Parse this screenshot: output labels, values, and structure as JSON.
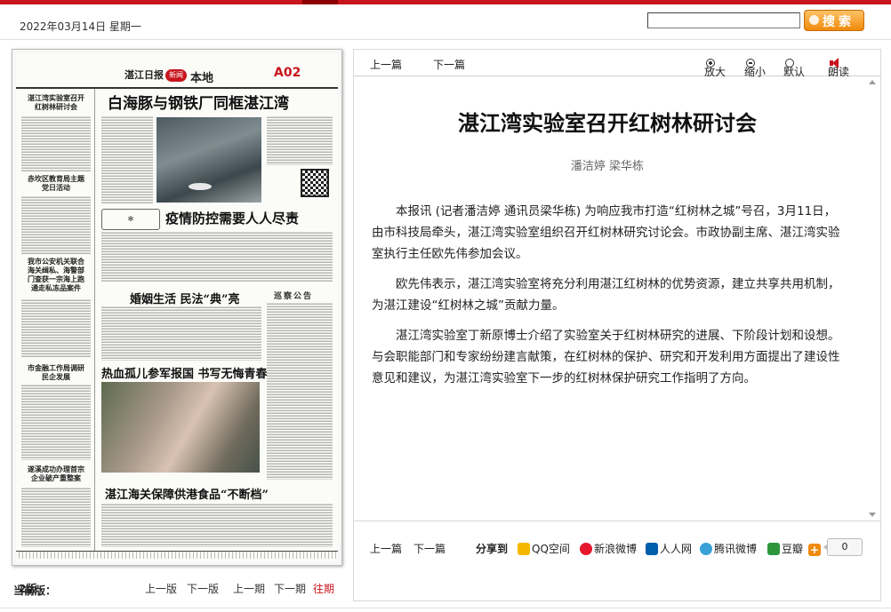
{
  "header": {
    "date": "2022年03月14日  星期一",
    "search_placeholder": "",
    "search_button": "搜索"
  },
  "newspaper": {
    "masthead_logo": "湛江日报",
    "section_badge": "新闻",
    "section_name": "本地",
    "page_code": "A02",
    "headlines": [
      "白海豚与钢铁厂同框湛江湾",
      "疫情防控需要人人尽责",
      "婚姻生活 民法“典”亮",
      "热血孤儿参军报国 书写无悔青春",
      "湛江海关保障供港食品“不断档”"
    ],
    "notice_title": "巡察公告",
    "side_headlines": [
      "湛江湾实验室召开红树林研讨会",
      "赤坎区教育局主题党日活动",
      "我市公安机关联合海关缉私、海警部门查获一宗海上跑通走私冻品案件",
      "市金融工作局调研民企发展",
      "遂溪成功办理首宗企业破产重整案"
    ]
  },
  "page_nav": {
    "current_label": "当前版：",
    "current_value": "2版",
    "prev_page": "上一版",
    "next_page": "下一版",
    "prev_issue": "上一期",
    "next_issue": "下一期",
    "past_issues": "往期"
  },
  "article": {
    "toolbar": {
      "prev": "上一篇",
      "next": "下一篇",
      "zoom_in": "放大",
      "zoom_out": "缩小",
      "default": "默认",
      "read_aloud": "朗读"
    },
    "title": "湛江湾实验室召开红树林研讨会",
    "byline": "潘洁婷 梁华栋",
    "paragraphs": [
      "本报讯 (记者潘洁婷 通讯员梁华栋) 为响应我市打造“红树林之城”号召，3月11日，由市科技局牵头，湛江湾实验室组织召开红树林研究讨论会。市政协副主席、湛江湾实验室执行主任欧先伟参加会议。",
      "欧先伟表示，湛江湾实验室将充分利用湛江红树林的优势资源，建立共享共用机制，为湛江建设“红树林之城”贡献力量。",
      "湛江湾实验室丁新原博士介绍了实验室关于红树林研究的进展、下阶段计划和设想。与会职能部门和专家纷纷建言献策，在红树林的保护、研究和开发利用方面提出了建设性意见和建议，为湛江湾实验室下一步的红树林保护研究工作指明了方向。"
    ],
    "bottom": {
      "prev": "上一篇",
      "next": "下一篇",
      "share_label": "分享到",
      "share_targets": [
        "QQ空间",
        "新浪微博",
        "人人网",
        "腾讯微博",
        "豆瓣"
      ],
      "share_count": "0"
    }
  },
  "colors": {
    "brand_red": "#c8141c",
    "search_orange": "#f08a0c"
  }
}
